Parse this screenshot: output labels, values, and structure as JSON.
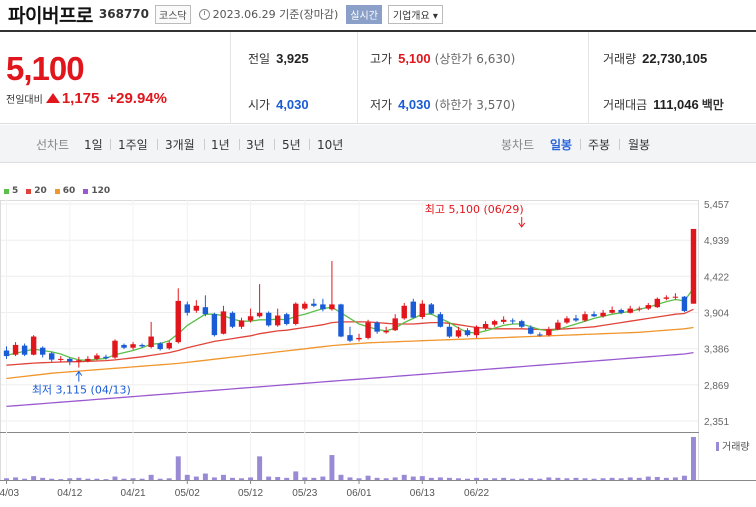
{
  "header": {
    "name": "파이버프로",
    "code": "368770",
    "market": "코스닥",
    "date": "2023.06.29 기준(장마감)",
    "realtime": "실시간",
    "company": "기업개요 ▾"
  },
  "price": {
    "current": "5,100",
    "change_label": "전일대비",
    "change": "1,175",
    "change_pct": "+29.94%"
  },
  "stats": {
    "prev_label": "전일",
    "prev": "3,925",
    "open_label": "시가",
    "open": "4,030",
    "high_label": "고가",
    "high": "5,100",
    "high_sub": "(상한가 6,630)",
    "low_label": "저가",
    "low": "4,030",
    "low_sub": "(하한가 3,570)",
    "volume_label": "거래량",
    "volume": "22,730,105",
    "amount_label": "거래대금",
    "amount": "111,046",
    "amount_unit": "백만"
  },
  "toolbar": {
    "line_label": "선차트",
    "periods": [
      "1일",
      "1주일",
      "3개월",
      "1년",
      "3년",
      "5년",
      "10년"
    ],
    "candle_label": "봉차트",
    "candles": [
      "일봉",
      "주봉",
      "월봉"
    ],
    "active_candle": "일봉"
  },
  "colors": {
    "up": "#e0161c",
    "down": "#1a5bd6",
    "ma5": "#5cbf4a",
    "ma20": "#e0453a",
    "ma60": "#f0962c",
    "ma120": "#9b59d0",
    "volume": "#9a8ad6"
  },
  "chart_data": {
    "type": "candlestick",
    "legend": [
      {
        "name": "5",
        "color": "#5cbf4a"
      },
      {
        "name": "20",
        "color": "#e0453a"
      },
      {
        "name": "60",
        "color": "#f0962c"
      },
      {
        "name": "120",
        "color": "#9b59d0"
      }
    ],
    "ylim": [
      2351,
      5457
    ],
    "yticks": [
      "5,457",
      "4,939",
      "4,422",
      "3,904",
      "3,386",
      "2,869",
      "2,351"
    ],
    "ytick_values": [
      5457,
      4939,
      4422,
      3904,
      3386,
      2869,
      2351
    ],
    "xticks": [
      "04/03",
      "04/12",
      "04/21",
      "05/02",
      "05/12",
      "05/23",
      "06/01",
      "06/13",
      "06/22"
    ],
    "xtick_index": [
      0,
      7,
      14,
      20,
      27,
      33,
      39,
      46,
      52
    ],
    "annotations": {
      "high": "최고 5,100 (06/29)",
      "high_index": 57,
      "high_value": 5100,
      "low": "최저 3,115 (04/13)",
      "low_index": 8,
      "low_value": 3115
    },
    "volume_label": "거래량",
    "candles": [
      {
        "o": 3360,
        "c": 3280,
        "h": 3420,
        "l": 3240
      },
      {
        "o": 3300,
        "c": 3440,
        "h": 3480,
        "l": 3280
      },
      {
        "o": 3430,
        "c": 3300,
        "h": 3460,
        "l": 3280
      },
      {
        "o": 3300,
        "c": 3560,
        "h": 3580,
        "l": 3290
      },
      {
        "o": 3400,
        "c": 3300,
        "h": 3420,
        "l": 3260
      },
      {
        "o": 3320,
        "c": 3230,
        "h": 3340,
        "l": 3200
      },
      {
        "o": 3230,
        "c": 3240,
        "h": 3280,
        "l": 3190
      },
      {
        "o": 3240,
        "c": 3200,
        "h": 3260,
        "l": 3150
      },
      {
        "o": 3200,
        "c": 3220,
        "h": 3270,
        "l": 3115
      },
      {
        "o": 3210,
        "c": 3240,
        "h": 3280,
        "l": 3190
      },
      {
        "o": 3240,
        "c": 3290,
        "h": 3320,
        "l": 3220
      },
      {
        "o": 3270,
        "c": 3250,
        "h": 3300,
        "l": 3230
      },
      {
        "o": 3260,
        "c": 3500,
        "h": 3520,
        "l": 3240
      },
      {
        "o": 3440,
        "c": 3400,
        "h": 3460,
        "l": 3380
      },
      {
        "o": 3400,
        "c": 3450,
        "h": 3480,
        "l": 3370
      },
      {
        "o": 3440,
        "c": 3420,
        "h": 3460,
        "l": 3400
      },
      {
        "o": 3410,
        "c": 3560,
        "h": 3770,
        "l": 3390
      },
      {
        "o": 3460,
        "c": 3380,
        "h": 3480,
        "l": 3360
      },
      {
        "o": 3390,
        "c": 3470,
        "h": 3500,
        "l": 3370
      },
      {
        "o": 3480,
        "c": 4070,
        "h": 4250,
        "l": 3460
      },
      {
        "o": 4020,
        "c": 3900,
        "h": 4060,
        "l": 3860
      },
      {
        "o": 3930,
        "c": 4000,
        "h": 4080,
        "l": 3900
      },
      {
        "o": 3980,
        "c": 3880,
        "h": 4150,
        "l": 3850
      },
      {
        "o": 3880,
        "c": 3580,
        "h": 3900,
        "l": 3560
      },
      {
        "o": 3600,
        "c": 3920,
        "h": 4000,
        "l": 3590
      },
      {
        "o": 3900,
        "c": 3700,
        "h": 3920,
        "l": 3680
      },
      {
        "o": 3700,
        "c": 3790,
        "h": 3830,
        "l": 3670
      },
      {
        "o": 3790,
        "c": 3850,
        "h": 3960,
        "l": 3760
      },
      {
        "o": 3850,
        "c": 3900,
        "h": 4310,
        "l": 3830
      },
      {
        "o": 3900,
        "c": 3720,
        "h": 3920,
        "l": 3700
      },
      {
        "o": 3720,
        "c": 3860,
        "h": 3960,
        "l": 3700
      },
      {
        "o": 3880,
        "c": 3740,
        "h": 3900,
        "l": 3720
      },
      {
        "o": 3740,
        "c": 4030,
        "h": 4050,
        "l": 3720
      },
      {
        "o": 3960,
        "c": 4030,
        "h": 4060,
        "l": 3940
      },
      {
        "o": 4030,
        "c": 4000,
        "h": 4100,
        "l": 3980
      },
      {
        "o": 4020,
        "c": 3950,
        "h": 4100,
        "l": 3920
      },
      {
        "o": 3950,
        "c": 4020,
        "h": 4640,
        "l": 3930
      },
      {
        "o": 4020,
        "c": 3560,
        "h": 4030,
        "l": 3550
      },
      {
        "o": 3580,
        "c": 3500,
        "h": 3700,
        "l": 3480
      },
      {
        "o": 3520,
        "c": 3540,
        "h": 3600,
        "l": 3490
      },
      {
        "o": 3540,
        "c": 3760,
        "h": 3800,
        "l": 3520
      },
      {
        "o": 3760,
        "c": 3630,
        "h": 3780,
        "l": 3600
      },
      {
        "o": 3620,
        "c": 3640,
        "h": 3700,
        "l": 3600
      },
      {
        "o": 3650,
        "c": 3820,
        "h": 3880,
        "l": 3640
      },
      {
        "o": 3820,
        "c": 4000,
        "h": 4040,
        "l": 3800
      },
      {
        "o": 4060,
        "c": 3830,
        "h": 4100,
        "l": 3820
      },
      {
        "o": 3840,
        "c": 4030,
        "h": 4080,
        "l": 3810
      },
      {
        "o": 4020,
        "c": 3890,
        "h": 4040,
        "l": 3880
      },
      {
        "o": 3880,
        "c": 3700,
        "h": 3910,
        "l": 3690
      },
      {
        "o": 3700,
        "c": 3560,
        "h": 3750,
        "l": 3540
      },
      {
        "o": 3560,
        "c": 3650,
        "h": 3700,
        "l": 3540
      },
      {
        "o": 3650,
        "c": 3580,
        "h": 3680,
        "l": 3560
      },
      {
        "o": 3580,
        "c": 3700,
        "h": 3720,
        "l": 3540
      },
      {
        "o": 3680,
        "c": 3740,
        "h": 3780,
        "l": 3650
      },
      {
        "o": 3730,
        "c": 3780,
        "h": 3800,
        "l": 3700
      },
      {
        "o": 3770,
        "c": 3800,
        "h": 3850,
        "l": 3740
      },
      {
        "o": 3790,
        "c": 3780,
        "h": 3820,
        "l": 3740
      },
      {
        "o": 3780,
        "c": 3700,
        "h": 3800,
        "l": 3680
      },
      {
        "o": 3690,
        "c": 3600,
        "h": 3720,
        "l": 3590
      },
      {
        "o": 3590,
        "c": 3580,
        "h": 3620,
        "l": 3560
      },
      {
        "o": 3580,
        "c": 3660,
        "h": 3700,
        "l": 3560
      },
      {
        "o": 3660,
        "c": 3760,
        "h": 3800,
        "l": 3650
      },
      {
        "o": 3760,
        "c": 3820,
        "h": 3850,
        "l": 3740
      },
      {
        "o": 3820,
        "c": 3790,
        "h": 3870,
        "l": 3770
      },
      {
        "o": 3790,
        "c": 3880,
        "h": 3920,
        "l": 3770
      },
      {
        "o": 3880,
        "c": 3850,
        "h": 3920,
        "l": 3840
      },
      {
        "o": 3850,
        "c": 3900,
        "h": 3940,
        "l": 3830
      },
      {
        "o": 3900,
        "c": 3940,
        "h": 3990,
        "l": 3890
      },
      {
        "o": 3940,
        "c": 3900,
        "h": 3960,
        "l": 3880
      },
      {
        "o": 3900,
        "c": 3960,
        "h": 4000,
        "l": 3890
      },
      {
        "o": 3960,
        "c": 3960,
        "h": 3990,
        "l": 3920
      },
      {
        "o": 3960,
        "c": 4010,
        "h": 4040,
        "l": 3940
      },
      {
        "o": 3980,
        "c": 4100,
        "h": 4120,
        "l": 3970
      },
      {
        "o": 4100,
        "c": 4120,
        "h": 4150,
        "l": 4080
      },
      {
        "o": 4120,
        "c": 4130,
        "h": 4180,
        "l": 4090
      },
      {
        "o": 4130,
        "c": 3925,
        "h": 4140,
        "l": 3910
      },
      {
        "o": 4030,
        "c": 5100,
        "h": 5100,
        "l": 4030
      }
    ],
    "volume": [
      0.04,
      0.06,
      0.03,
      0.09,
      0.05,
      0.03,
      0.02,
      0.04,
      0.05,
      0.03,
      0.03,
      0.02,
      0.08,
      0.03,
      0.04,
      0.03,
      0.12,
      0.03,
      0.04,
      0.55,
      0.12,
      0.08,
      0.15,
      0.06,
      0.12,
      0.05,
      0.04,
      0.06,
      0.55,
      0.08,
      0.07,
      0.05,
      0.2,
      0.06,
      0.05,
      0.08,
      0.58,
      0.12,
      0.06,
      0.04,
      0.1,
      0.05,
      0.04,
      0.06,
      0.12,
      0.08,
      0.09,
      0.05,
      0.06,
      0.05,
      0.04,
      0.03,
      0.05,
      0.04,
      0.04,
      0.05,
      0.03,
      0.03,
      0.04,
      0.03,
      0.06,
      0.05,
      0.04,
      0.05,
      0.04,
      0.03,
      0.04,
      0.05,
      0.04,
      0.06,
      0.05,
      0.08,
      0.07,
      0.05,
      0.06,
      0.1,
      1.0
    ],
    "ma5": [
      3290,
      3320,
      3350,
      3380,
      3360,
      3340,
      3310,
      3260,
      3225,
      3220,
      3235,
      3245,
      3300,
      3330,
      3360,
      3400,
      3450,
      3460,
      3500,
      3600,
      3720,
      3800,
      3880,
      3880,
      3860,
      3810,
      3780,
      3780,
      3800,
      3800,
      3810,
      3800,
      3850,
      3880,
      3920,
      3960,
      3980,
      3900,
      3820,
      3740,
      3700,
      3660,
      3640,
      3680,
      3760,
      3820,
      3880,
      3880,
      3820,
      3760,
      3680,
      3620,
      3610,
      3640,
      3680,
      3720,
      3740,
      3740,
      3700,
      3660,
      3640,
      3660,
      3700,
      3740,
      3780,
      3820,
      3850,
      3880,
      3900,
      3920,
      3950,
      3980,
      4020,
      4060,
      4090,
      4070,
      4250
    ],
    "ma20": [
      3150,
      3160,
      3170,
      3180,
      3185,
      3190,
      3195,
      3200,
      3200,
      3205,
      3210,
      3215,
      3225,
      3240,
      3255,
      3270,
      3290,
      3310,
      3330,
      3360,
      3400,
      3430,
      3460,
      3490,
      3510,
      3530,
      3550,
      3570,
      3600,
      3620,
      3640,
      3650,
      3670,
      3690,
      3710,
      3730,
      3760,
      3770,
      3770,
      3770,
      3770,
      3760,
      3750,
      3740,
      3740,
      3740,
      3750,
      3760,
      3760,
      3750,
      3730,
      3710,
      3690,
      3680,
      3670,
      3670,
      3670,
      3670,
      3665,
      3660,
      3660,
      3665,
      3670,
      3680,
      3690,
      3700,
      3720,
      3740,
      3760,
      3780,
      3800,
      3820,
      3840,
      3860,
      3880,
      3890,
      3950
    ],
    "ma60": [
      2960,
      2975,
      2990,
      3005,
      3020,
      3035,
      3045,
      3055,
      3065,
      3075,
      3085,
      3095,
      3105,
      3115,
      3125,
      3135,
      3145,
      3155,
      3165,
      3175,
      3190,
      3205,
      3220,
      3235,
      3250,
      3265,
      3280,
      3295,
      3310,
      3325,
      3340,
      3355,
      3370,
      3385,
      3400,
      3415,
      3430,
      3440,
      3450,
      3460,
      3470,
      3475,
      3480,
      3485,
      3490,
      3495,
      3500,
      3505,
      3510,
      3515,
      3520,
      3525,
      3530,
      3535,
      3540,
      3545,
      3550,
      3555,
      3560,
      3565,
      3570,
      3575,
      3580,
      3585,
      3590,
      3595,
      3600,
      3605,
      3610,
      3615,
      3620,
      3630,
      3640,
      3650,
      3660,
      3670,
      3690
    ],
    "ma120": [
      2560,
      2570,
      2580,
      2590,
      2600,
      2610,
      2620,
      2630,
      2640,
      2650,
      2660,
      2670,
      2680,
      2690,
      2700,
      2710,
      2720,
      2730,
      2740,
      2750,
      2760,
      2770,
      2780,
      2790,
      2800,
      2810,
      2820,
      2830,
      2840,
      2850,
      2860,
      2870,
      2880,
      2890,
      2900,
      2910,
      2920,
      2930,
      2940,
      2950,
      2960,
      2970,
      2980,
      2990,
      3000,
      3010,
      3020,
      3030,
      3040,
      3050,
      3060,
      3070,
      3080,
      3090,
      3100,
      3110,
      3120,
      3130,
      3140,
      3150,
      3160,
      3170,
      3180,
      3190,
      3200,
      3210,
      3220,
      3230,
      3240,
      3250,
      3260,
      3270,
      3280,
      3290,
      3300,
      3310,
      3330
    ]
  }
}
